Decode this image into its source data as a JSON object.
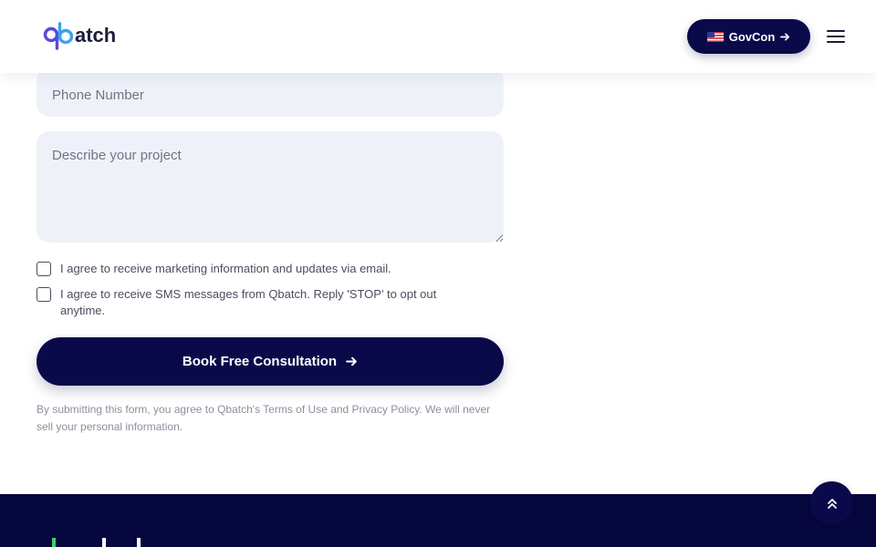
{
  "header": {
    "logo_text": "qbatch",
    "govcon_label": "GovCon"
  },
  "form": {
    "phone_placeholder": "Phone Number",
    "project_placeholder": "Describe your project",
    "consent_email": "I agree to receive marketing information and updates via email.",
    "consent_sms": "I agree to receive SMS messages from Qbatch. Reply 'STOP' to opt out anytime.",
    "submit_label": "Book Free Consultation",
    "disclaimer": "By submitting this form, you agree to Qbatch's Terms of Use and Privacy Policy. We will never sell your personal information."
  },
  "colors": {
    "navy": "#0a0a4a",
    "footer": "#07073f",
    "logo_purple": "#5a48d8",
    "field_bg": "#eef2f8",
    "footer_logo_green": "#3ccf6e"
  },
  "icons": {
    "govcon_flag": "us-flag-icon",
    "govcon_arrow": "arrow-right-icon",
    "menu": "hamburger-menu-icon",
    "submit_arrow": "arrow-right-icon",
    "scroll_top": "double-chevron-up-icon"
  }
}
